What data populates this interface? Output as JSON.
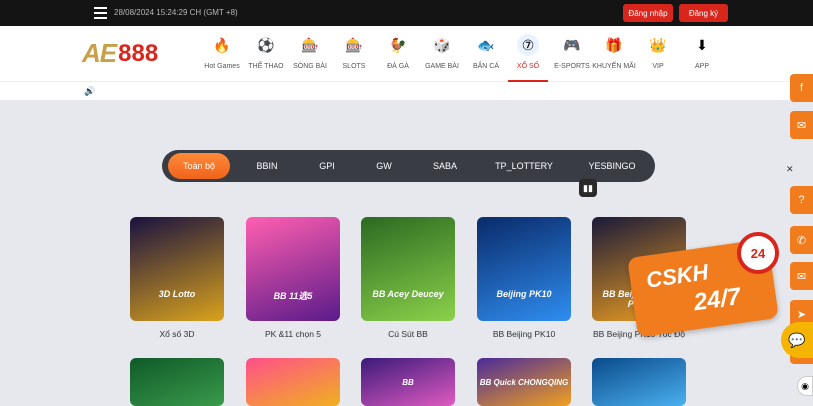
{
  "topbar": {
    "datetime": "28/08/2024 15:24:29 CH (GMT +8)",
    "login_label": "Đăng nhập",
    "register_label": "Đăng ký"
  },
  "brand": {
    "logo_ae": "AE",
    "logo_num": "888"
  },
  "nav": [
    {
      "label": "Hot Games",
      "icon": "fire-icon",
      "glyph": "🔥",
      "active": false
    },
    {
      "label": "THỂ THAO",
      "icon": "soccer-ball-icon",
      "glyph": "⚽",
      "active": false
    },
    {
      "label": "SÒNG BÀI",
      "icon": "casino-dealer-icon",
      "glyph": "🎰",
      "active": false
    },
    {
      "label": "SLOTS",
      "icon": "slot-machine-icon",
      "glyph": "🎰",
      "active": false
    },
    {
      "label": "ĐÁ GÀ",
      "icon": "rooster-icon",
      "glyph": "🐓",
      "active": false
    },
    {
      "label": "GAME BÀI",
      "icon": "dice-cards-icon",
      "glyph": "🎲",
      "active": false
    },
    {
      "label": "BẮN CÁ",
      "icon": "fish-icon",
      "glyph": "🐟",
      "active": false
    },
    {
      "label": "XỔ SỐ",
      "icon": "lottery-ball-icon",
      "glyph": "⑦",
      "active": true
    },
    {
      "label": "E-SPORTS",
      "icon": "gamepad-icon",
      "glyph": "🎮",
      "active": false
    },
    {
      "label": "KHUYẾN MÃI",
      "icon": "gift-icon",
      "glyph": "🎁",
      "active": false
    },
    {
      "label": "VIP",
      "icon": "crown-icon",
      "glyph": "👑",
      "active": false
    },
    {
      "label": "APP",
      "icon": "download-icon",
      "glyph": "⬇",
      "active": false
    }
  ],
  "filters": {
    "tabs": [
      "Toàn bộ",
      "BBIN",
      "GPI",
      "GW",
      "SABA",
      "TP_LOTTERY",
      "YESBINGO"
    ],
    "active": "Toàn bộ"
  },
  "games": [
    {
      "title": "Xổ số 3D",
      "art": "3D Lotto",
      "colors": [
        "#1a1240",
        "#d9a21c"
      ]
    },
    {
      "title": "PK &11 chọn 5",
      "art": "BB 11选5",
      "colors": [
        "#ff5fb0",
        "#5a1b8a"
      ]
    },
    {
      "title": "Cú Sút BB",
      "art": "BB Acey Deucey",
      "colors": [
        "#2b6a22",
        "#8bd14a"
      ]
    },
    {
      "title": "BB Beijing PK10",
      "art": "Beijing PK10",
      "colors": [
        "#0a2a6a",
        "#2f8ef0"
      ]
    },
    {
      "title": "BB Beijing PK10 Tốc Độ",
      "art": "BB Beijing Quick PK10",
      "colors": [
        "#1a1a3a",
        "#f0a020"
      ]
    }
  ],
  "games_row2": [
    {
      "art": "",
      "colors": [
        "#0f5a2a",
        "#3a9a4a"
      ]
    },
    {
      "art": "",
      "colors": [
        "#ff4f8a",
        "#f0b020"
      ]
    },
    {
      "art": "BB",
      "colors": [
        "#3a1a7a",
        "#e05ac0"
      ]
    },
    {
      "art": "BB Quick CHONGQING",
      "colors": [
        "#4a2a9a",
        "#f0a020"
      ]
    },
    {
      "art": "",
      "colors": [
        "#0a4a8a",
        "#4ab0f0"
      ]
    }
  ],
  "support": {
    "title": "CSKH",
    "hours": "24/7",
    "clock_label": "24"
  },
  "sidebar_icons": [
    "facebook-icon",
    "messenger-icon",
    "telegram-icon",
    "help-icon",
    "phone-icon",
    "email-icon",
    "telegram-plane-icon",
    "zalo-icon"
  ]
}
